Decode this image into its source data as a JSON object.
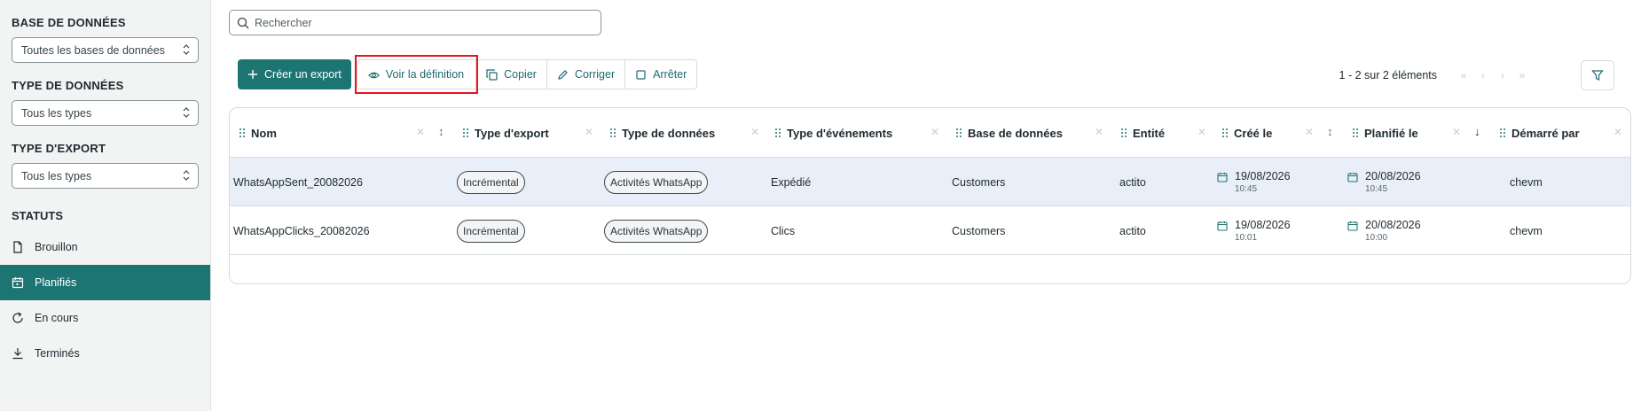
{
  "sidebar": {
    "filters": [
      {
        "title": "BASE DE DONNÉES",
        "value": "Toutes les bases de données"
      },
      {
        "title": "TYPE DE DONNÉES",
        "value": "Tous les types"
      },
      {
        "title": "TYPE D'EXPORT",
        "value": "Tous les types"
      }
    ],
    "statuts_title": "STATUTS",
    "statuses": [
      {
        "label": "Brouillon",
        "icon": "file-icon"
      },
      {
        "label": "Planifiés",
        "icon": "calendar-icon",
        "active": true
      },
      {
        "label": "En cours",
        "icon": "refresh-icon"
      },
      {
        "label": "Terminés",
        "icon": "download-icon"
      }
    ]
  },
  "search": {
    "placeholder": "Rechercher"
  },
  "toolbar": {
    "create_label": "Créer un export",
    "view_label": "Voir la définition",
    "copy_label": "Copier",
    "fix_label": "Corriger",
    "stop_label": "Arrêter"
  },
  "pager": {
    "summary": "1 - 2 sur 2 éléments"
  },
  "table": {
    "columns": [
      "Nom",
      "Type d'export",
      "Type de données",
      "Type d'événements",
      "Base de données",
      "Entité",
      "Créé le",
      "Planifié le",
      "Démarré par"
    ],
    "rows": [
      {
        "nom": "WhatsAppSent_20082026",
        "type_export": "Incrémental",
        "type_donnees": "Activités WhatsApp",
        "type_evenements": "Expédié",
        "base": "Customers",
        "entite": "actito",
        "cree_date": "19/08/2026",
        "cree_heure": "10:45",
        "planifie_date": "20/08/2026",
        "planifie_heure": "10:45",
        "demarre_par": "chevm"
      },
      {
        "nom": "WhatsAppClicks_20082026",
        "type_export": "Incrémental",
        "type_donnees": "Activités WhatsApp",
        "type_evenements": "Clics",
        "base": "Customers",
        "entite": "actito",
        "cree_date": "19/08/2026",
        "cree_heure": "10:01",
        "planifie_date": "20/08/2026",
        "planifie_heure": "10:00",
        "demarre_par": "chevm"
      }
    ]
  },
  "colors": {
    "accent": "#1d7573",
    "highlight": "#e8141f",
    "selected_row": "#e8eff8"
  }
}
